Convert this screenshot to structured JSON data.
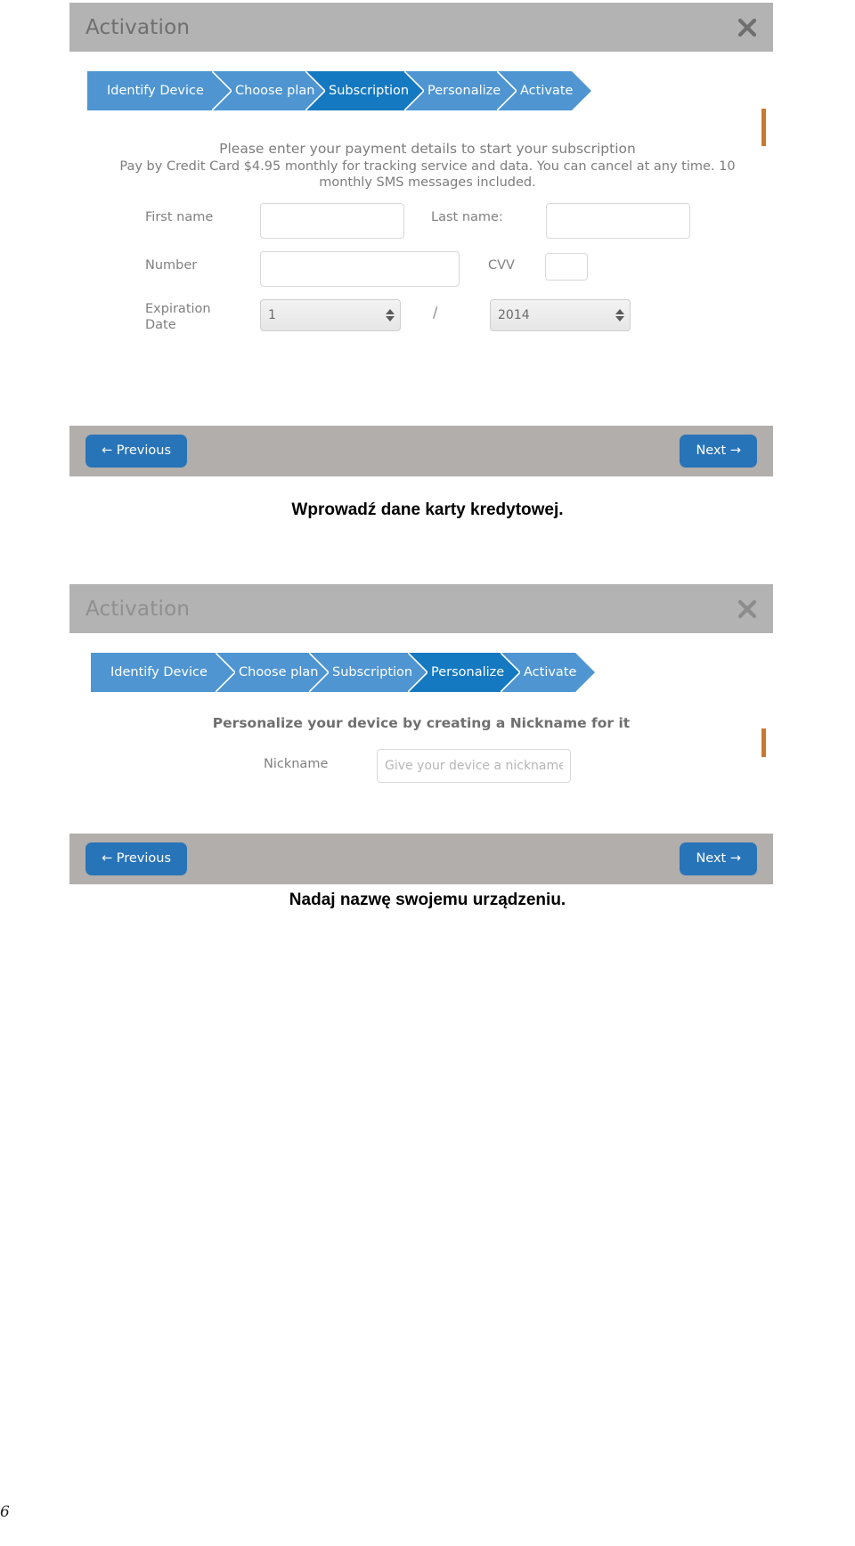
{
  "page": {
    "page_number": "6"
  },
  "panel1": {
    "title": "Activation",
    "close_icon": "close-icon",
    "steps": [
      {
        "label": "Identify Device",
        "active": false
      },
      {
        "label": "Choose plan",
        "active": false
      },
      {
        "label": "Subscription",
        "active": true
      },
      {
        "label": "Personalize",
        "active": false
      },
      {
        "label": "Activate",
        "active": false
      }
    ],
    "intro_line1": "Please enter your payment details to start your subscription",
    "intro_line2": "Pay by Credit Card $4.95 monthly for tracking service and data. You can cancel at any time. 10 monthly SMS messages included.",
    "fields": {
      "first_name_label": "First name",
      "first_name_value": "",
      "first_name_placeholder": "",
      "last_name_label": "Last name:",
      "last_name_value": "",
      "last_name_placeholder": "",
      "number_label": "Number",
      "number_value": "",
      "number_placeholder": "",
      "cvv_label": "CVV",
      "cvv_value": "",
      "cvv_placeholder": "",
      "expiration_label_line1": "Expiration",
      "expiration_label_line2": "Date",
      "expiration_month": "1",
      "expiration_separator": "/",
      "expiration_year": "2014"
    },
    "footer": {
      "previous_label": "← Previous",
      "next_label": "Next →"
    },
    "caption": "Wprowadź dane karty kredytowej."
  },
  "panel2": {
    "title": "Activation",
    "close_icon": "close-icon",
    "steps": [
      {
        "label": "Identify Device",
        "active": false
      },
      {
        "label": "Choose plan",
        "active": false
      },
      {
        "label": "Subscription",
        "active": false
      },
      {
        "label": "Personalize",
        "active": true
      },
      {
        "label": "Activate",
        "active": false
      }
    ],
    "heading": "Personalize your device by creating a Nickname for it",
    "fields": {
      "nickname_label": "Nickname",
      "nickname_value": "",
      "nickname_placeholder": "Give your device a nickname.."
    },
    "footer": {
      "previous_label": "← Previous",
      "next_label": "Next →"
    },
    "caption": "Nadaj nazwę swojemu urządzeniu."
  },
  "colors": {
    "header_gray": "#b3b3b3",
    "footer_gray": "#b2aeab",
    "step_blue": "#4e95d1",
    "step_blue_active": "#1579c1",
    "button_blue": "#2874b8",
    "label_gray": "#808080"
  }
}
